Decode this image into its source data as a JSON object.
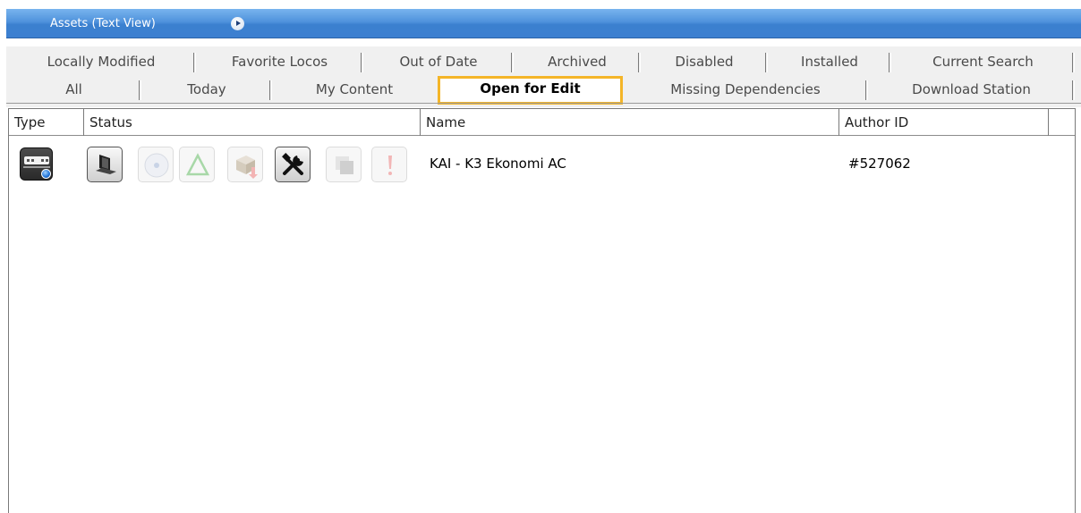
{
  "window": {
    "title": "Assets (Text View)"
  },
  "tabs": {
    "row1": [
      "Locally Modified",
      "Favorite Locos",
      "Out of Date",
      "Archived",
      "Disabled",
      "Installed",
      "Current Search"
    ],
    "row2": [
      "All",
      "Today",
      "My Content",
      "Open for Edit",
      "Missing Dependencies",
      "Download Station"
    ],
    "active": "Open for Edit",
    "accent_color": "#f4b528"
  },
  "columns": [
    "Type",
    "Status",
    "Name",
    "Author ID"
  ],
  "rows": [
    {
      "type_icon": "locomotive-icon",
      "status_icons": [
        "local-computer-icon",
        "cd-disc-icon",
        "warning-triangle-icon",
        "download-package-icon",
        "open-for-edit-tools-icon",
        "copy-squares-icon",
        "error-exclamation-icon"
      ],
      "name": "KAI - K3 Ekonomi AC",
      "author_id": "#527062"
    }
  ],
  "colors": {
    "titlebar": "#4f92dc",
    "tab_background": "#f0f0f0"
  }
}
